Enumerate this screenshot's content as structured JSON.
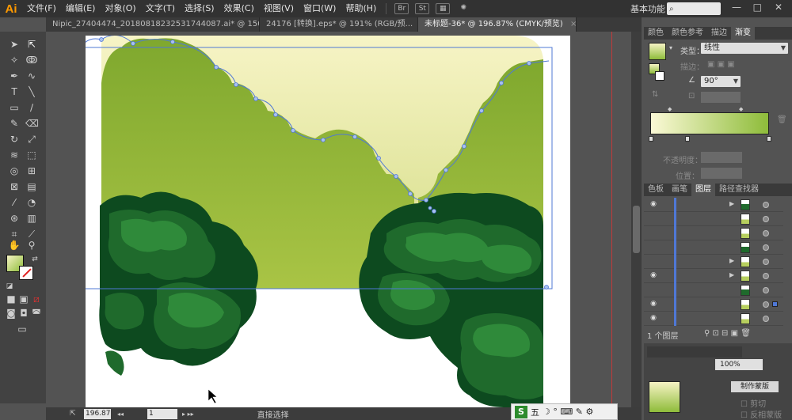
{
  "app": {
    "logo": "Ai"
  },
  "menu": [
    "文件(F)",
    "编辑(E)",
    "对象(O)",
    "文字(T)",
    "选择(S)",
    "效果(C)",
    "视图(V)",
    "窗口(W)",
    "帮助(H)"
  ],
  "menu_icons": {
    "bridge": "Br",
    "stock": "St"
  },
  "workspace_label": "基本功能",
  "search_placeholder": "",
  "window_controls": [
    "—",
    "□",
    "✕"
  ],
  "tabs": [
    {
      "label": "Nipic_27404474_20180818232531744087.ai* @ 150% (CMYK/预...",
      "active": false
    },
    {
      "label": "24176 [转换].eps* @ 191% (RGB/预...",
      "active": false
    },
    {
      "label": "未标题-36* @ 196.87% (CMYK/预览)",
      "active": true
    }
  ],
  "tab_close": "×",
  "right_panel": {
    "top_tabs": [
      "颜色",
      "颜色参考",
      "描边",
      "渐变"
    ],
    "gradient": {
      "type_label": "类型：",
      "type_value": "线性",
      "stroke_label": "描边：",
      "angle_value": "90°",
      "opacity_label": "不透明度：",
      "position_label": "位置：",
      "colors": {
        "start": "#fbf9d6",
        "end": "#8ebc3a"
      }
    },
    "layer_tabs": [
      "色板",
      "画笔",
      "图层",
      "路径查找器"
    ],
    "layers_footer": "1 个图层",
    "layer_rows": [
      {
        "visible": true,
        "expand": true,
        "selected": false
      },
      {
        "visible": false,
        "expand": false,
        "selected": false
      },
      {
        "visible": false,
        "expand": false,
        "selected": false
      },
      {
        "visible": false,
        "expand": false,
        "selected": false
      },
      {
        "visible": false,
        "expand": true,
        "selected": false
      },
      {
        "visible": true,
        "expand": true,
        "selected": false
      },
      {
        "visible": false,
        "expand": false,
        "selected": false
      },
      {
        "visible": true,
        "expand": false,
        "selected": true
      },
      {
        "visible": true,
        "expand": false,
        "selected": false
      }
    ],
    "bottom_panel": {
      "checkbox_clip": "剪切",
      "checkbox_invert": "反相蒙版",
      "button_mask": "制作蒙版",
      "percent": "100%"
    }
  },
  "status": {
    "zoom": "196.87",
    "page": "1",
    "tool": "直接选择"
  },
  "ime": {
    "logo": "S",
    "mode": "五",
    "icons": "☽ ° ⌨ ✎ ⚙"
  },
  "artwork": {
    "sky_top": "#f6f3c4",
    "sky_bottom": "#d8e08a",
    "hill_light": "#8cb838",
    "hill_dark": "#6e9e2a",
    "bush_dark": "#0d4a1f",
    "bush_mid": "#1f6a2c",
    "bush_light": "#2f8a3a"
  }
}
